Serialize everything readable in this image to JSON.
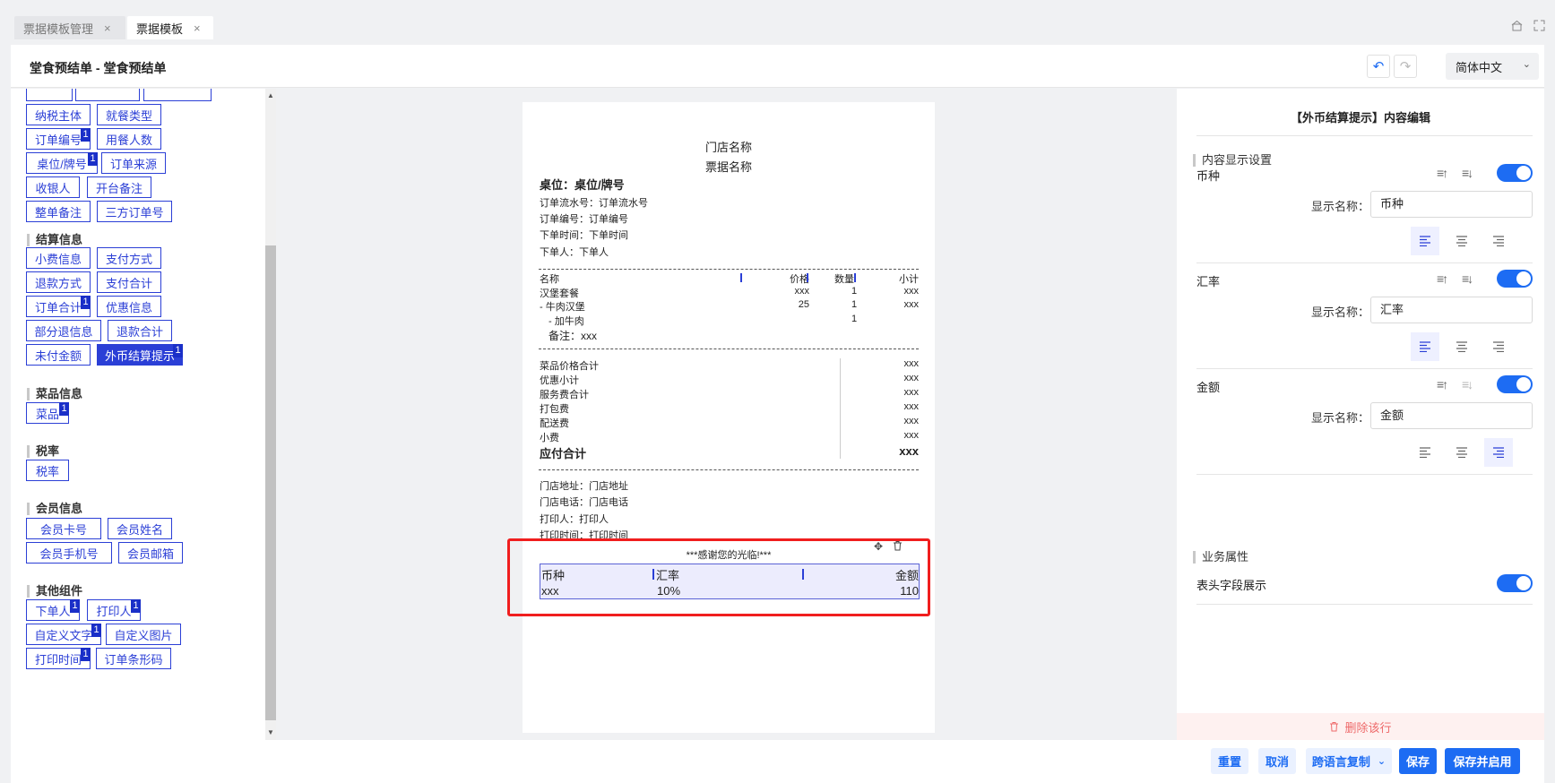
{
  "tabs": [
    {
      "label": "票据模板管理",
      "close": "×"
    },
    {
      "label": "票据模板",
      "close": "×"
    }
  ],
  "header": {
    "title": "堂食预结单 - 堂食预结单",
    "undo": "↶",
    "redo": "↷",
    "language": "简体中文",
    "chevron": "⌄"
  },
  "left": {
    "top_chips": [
      {
        "label": "纳税主体"
      },
      {
        "label": "就餐类型"
      },
      {
        "label": "订单编号",
        "badge": "1"
      },
      {
        "label": "用餐人数"
      },
      {
        "label": "桌位/牌号",
        "badge": "1"
      },
      {
        "label": "订单来源"
      },
      {
        "label": "收银人"
      },
      {
        "label": "开台备注"
      },
      {
        "label": "整单备注"
      },
      {
        "label": "三方订单号"
      }
    ],
    "sections": [
      {
        "title": "结算信息",
        "chips": [
          {
            "label": "小费信息"
          },
          {
            "label": "支付方式"
          },
          {
            "label": "退款方式"
          },
          {
            "label": "支付合计"
          },
          {
            "label": "订单合计",
            "badge": "1"
          },
          {
            "label": "优惠信息"
          },
          {
            "label": "部分退信息"
          },
          {
            "label": "退款合计"
          },
          {
            "label": "未付金额"
          },
          {
            "label": "外币结算提示",
            "badge": "1"
          }
        ]
      },
      {
        "title": "菜品信息",
        "chips": [
          {
            "label": "菜品",
            "badge": "1"
          }
        ]
      },
      {
        "title": "税率",
        "chips": [
          {
            "label": "税率"
          }
        ]
      },
      {
        "title": "会员信息",
        "chips": [
          {
            "label": "会员卡号"
          },
          {
            "label": "会员姓名"
          },
          {
            "label": "会员手机号"
          },
          {
            "label": "会员邮箱"
          }
        ]
      },
      {
        "title": "其他组件",
        "chips": [
          {
            "label": "下单人",
            "badge": "1"
          },
          {
            "label": "打印人",
            "badge": "1"
          },
          {
            "label": "自定义文字",
            "badge": "1"
          },
          {
            "label": "自定义图片"
          },
          {
            "label": "打印时间",
            "badge": "1"
          },
          {
            "label": "订单条形码"
          }
        ]
      }
    ]
  },
  "receipt": {
    "store_name": "门店名称",
    "receipt_name": "票据名称",
    "table": "桌位：桌位/牌号",
    "info": [
      "订单流水号：订单流水号",
      "订单编号：订单编号",
      "下单时间：下单时间",
      "下单人：下单人"
    ],
    "item_headers": [
      "名称",
      "价格",
      "数量",
      "小计"
    ],
    "items": [
      [
        "汉堡套餐",
        "xxx",
        "1",
        "xxx"
      ],
      [
        "- 牛肉汉堡",
        "25",
        "1",
        "xxx"
      ],
      [
        "- 加牛肉",
        "",
        "1",
        ""
      ]
    ],
    "remark": "备注：xxx",
    "totals": [
      [
        "菜品价格合计",
        "xxx"
      ],
      [
        "优惠小计",
        "xxx"
      ],
      [
        "服务费合计",
        "xxx"
      ],
      [
        "打包费",
        "xxx"
      ],
      [
        "配送费",
        "xxx"
      ],
      [
        "小费",
        "xxx"
      ]
    ],
    "total_due_label": "应付合计",
    "total_due_value": "xxx",
    "footer_info": [
      "门店地址：门店地址",
      "门店电话：门店电话",
      "打印人：打印人",
      "打印时间：打印时间"
    ],
    "thanks": "***感谢您的光临!***",
    "fx_headers": [
      "币种",
      "汇率",
      "金额"
    ],
    "fx_values": [
      "xxx",
      "10%",
      "110"
    ]
  },
  "right": {
    "title": "【外币结算提示】内容编辑",
    "content_section": "内容显示设置",
    "display_name_label": "显示名称：",
    "fields": [
      {
        "label": "币种",
        "display": "币种"
      },
      {
        "label": "汇率",
        "display": "汇率"
      },
      {
        "label": "金额",
        "display": "金额"
      }
    ],
    "business_section": "业务属性",
    "header_field_label": "表头字段展示",
    "delete_row": "删除该行"
  },
  "footer": {
    "reset": "重置",
    "cancel": "取消",
    "copy": "跨语言复制",
    "save": "保存",
    "save_enable": "保存并启用"
  }
}
